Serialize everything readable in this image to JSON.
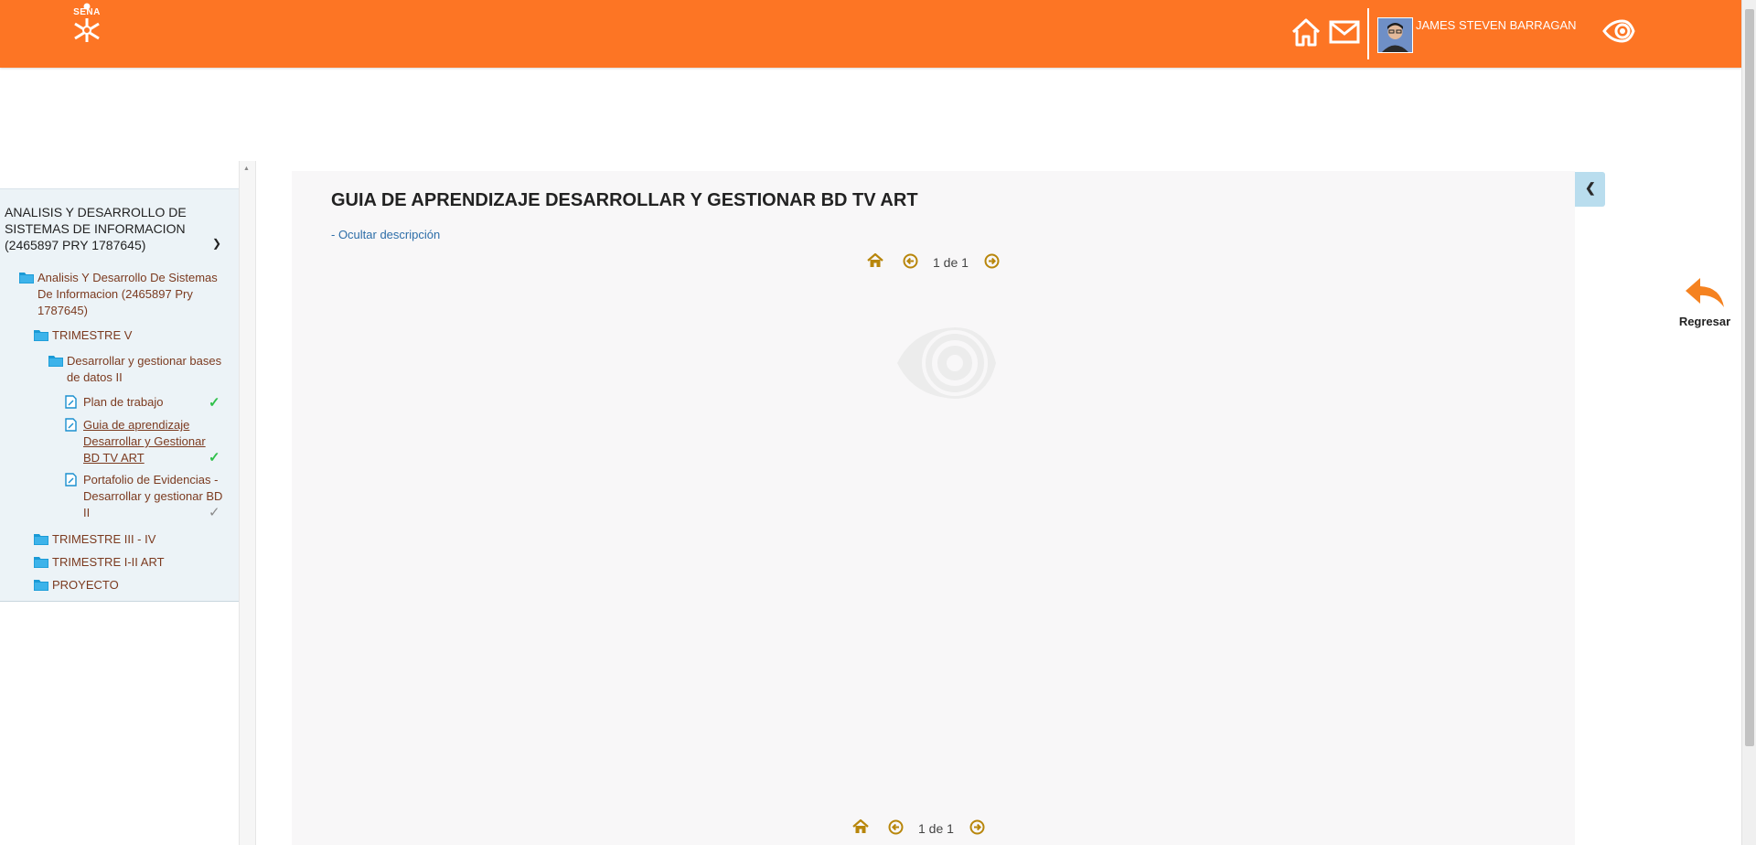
{
  "header": {
    "logo_text": "SENA",
    "username": "JAMES STEVEN BARRAGAN",
    "icons": [
      "home-icon",
      "mail-icon",
      "eye-icon"
    ],
    "accent_color": "#fd7524"
  },
  "sidebar": {
    "course_title": "ANALISIS Y DESARROLLO DE SISTEMAS DE INFORMACION (2465897 PRY 1787645)",
    "nodes": [
      {
        "label": "Analisis Y Desarrollo De Sistemas De Informacion (2465897 Pry 1787645)",
        "type": "folder"
      },
      {
        "label": "TRIMESTRE V",
        "type": "folder"
      },
      {
        "label": "Desarrollar y gestionar bases de datos II",
        "type": "folder"
      },
      {
        "label": "Plan de trabajo",
        "type": "document",
        "status": "completed"
      },
      {
        "label": "Guia de aprendizaje Desarrollar y Gestionar BD TV ART",
        "type": "document",
        "status": "completed",
        "active": true
      },
      {
        "label": "Portafolio de Evidencias - Desarrollar y gestionar BD II",
        "type": "document",
        "status": "pending"
      },
      {
        "label": "TRIMESTRE III - IV",
        "type": "folder"
      },
      {
        "label": "TRIMESTRE I-II ART",
        "type": "folder"
      },
      {
        "label": "PROYECTO",
        "type": "folder"
      }
    ]
  },
  "content": {
    "title": "GUIA DE APRENDIZAJE DESARROLLAR Y GESTIONAR BD TV ART",
    "hide_description": "- Ocultar descripción",
    "pager_top": "1 de 1",
    "pager_bottom": "1 de 1"
  },
  "back_button": {
    "label": "Regresar"
  }
}
